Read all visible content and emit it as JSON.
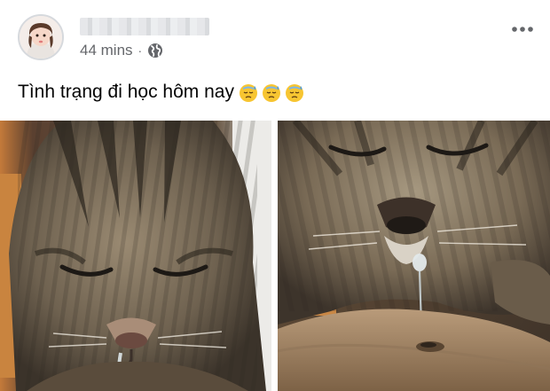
{
  "post": {
    "author_name": "",
    "timestamp": "44 mins",
    "separator": "·",
    "privacy_icon": "globe-icon",
    "more_icon": "more-horizontal-icon",
    "text": "Tình trạng đi học hôm nay",
    "emojis": [
      "downcast-face-with-sweat-icon",
      "downcast-face-with-sweat-icon",
      "downcast-face-with-sweat-icon"
    ],
    "photos": [
      {
        "subject": "cat-photo"
      },
      {
        "subject": "cat-photo"
      }
    ]
  },
  "colors": {
    "secondary_text": "#65676b",
    "primary_text": "#050505",
    "emoji_face": "#f7c531",
    "emoji_sweat": "#4a9be0"
  }
}
